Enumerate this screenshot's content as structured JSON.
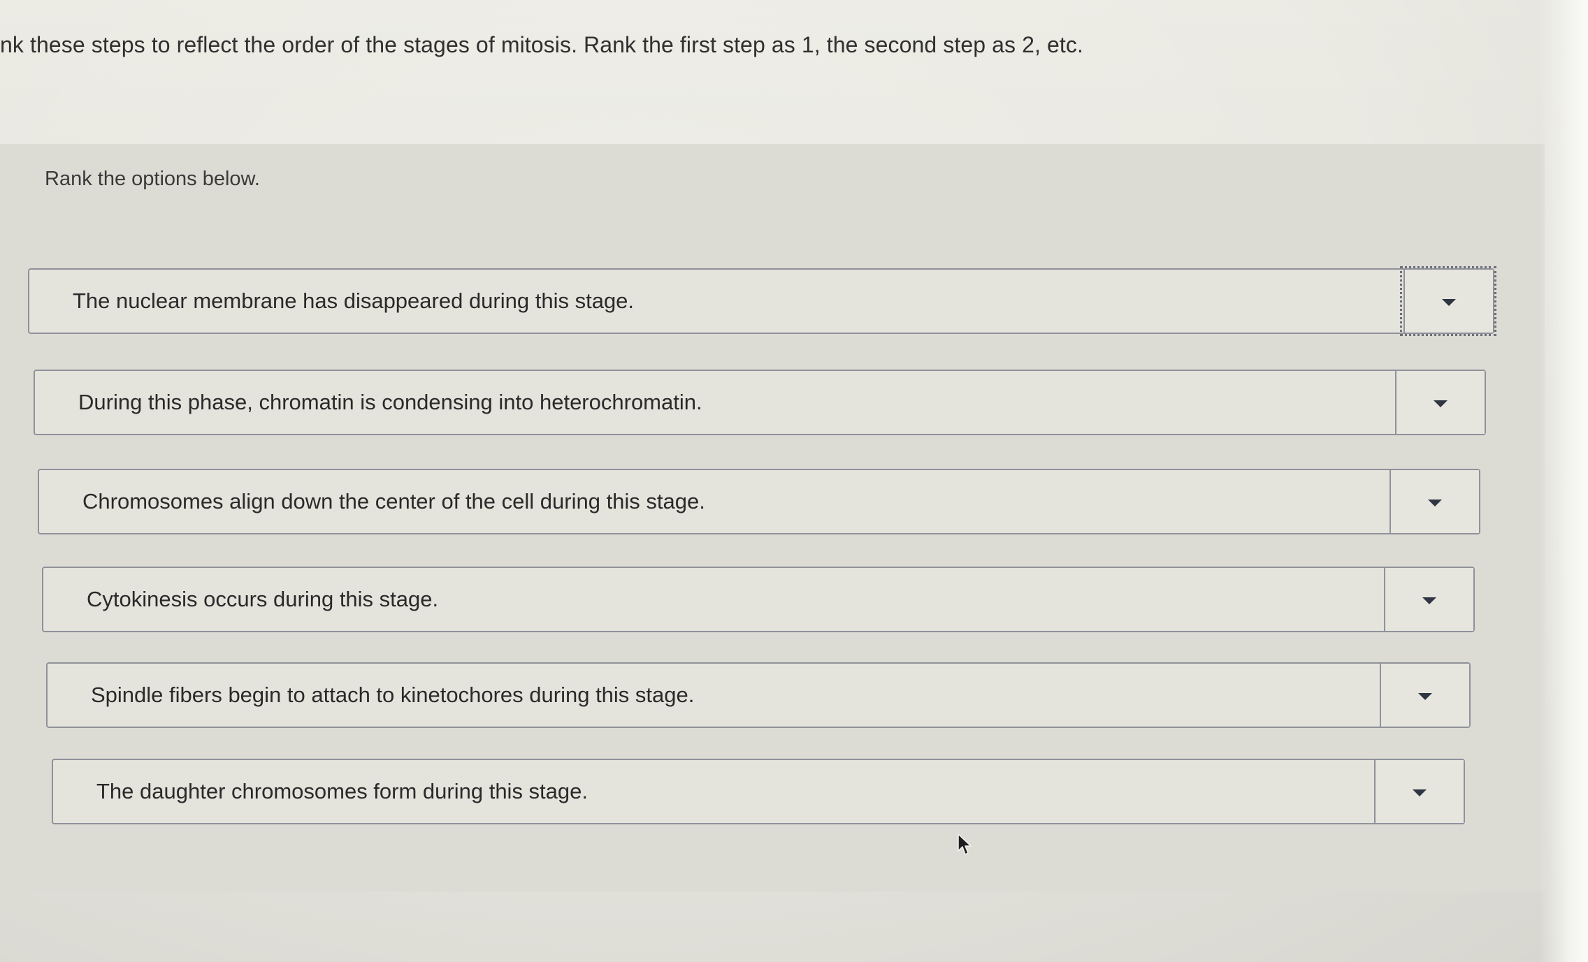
{
  "question": {
    "instructions": "nk these steps to reflect the order of the stages of mitosis. Rank the first step as 1, the second step as 2, etc.",
    "rank_prompt": "Rank the options below."
  },
  "options": [
    {
      "text": "The nuclear membrane has disappeared during this stage.",
      "rank": ""
    },
    {
      "text": "During this phase, chromatin is condensing into heterochromatin.",
      "rank": ""
    },
    {
      "text": "Chromosomes align down the center of the cell during this stage.",
      "rank": ""
    },
    {
      "text": "Cytokinesis occurs during this stage.",
      "rank": ""
    },
    {
      "text": "Spindle fibers begin to attach to kinetochores during this stage.",
      "rank": ""
    },
    {
      "text": "The daughter chromosomes form during this stage.",
      "rank": ""
    }
  ],
  "icons": {
    "dropdown": "chevron-down-icon",
    "pointer": "mouse-pointer-icon"
  },
  "colors": {
    "background": "#e6e5de",
    "panel": "#dcdbd4",
    "border": "#8f929a",
    "caret": "#2f3542"
  }
}
